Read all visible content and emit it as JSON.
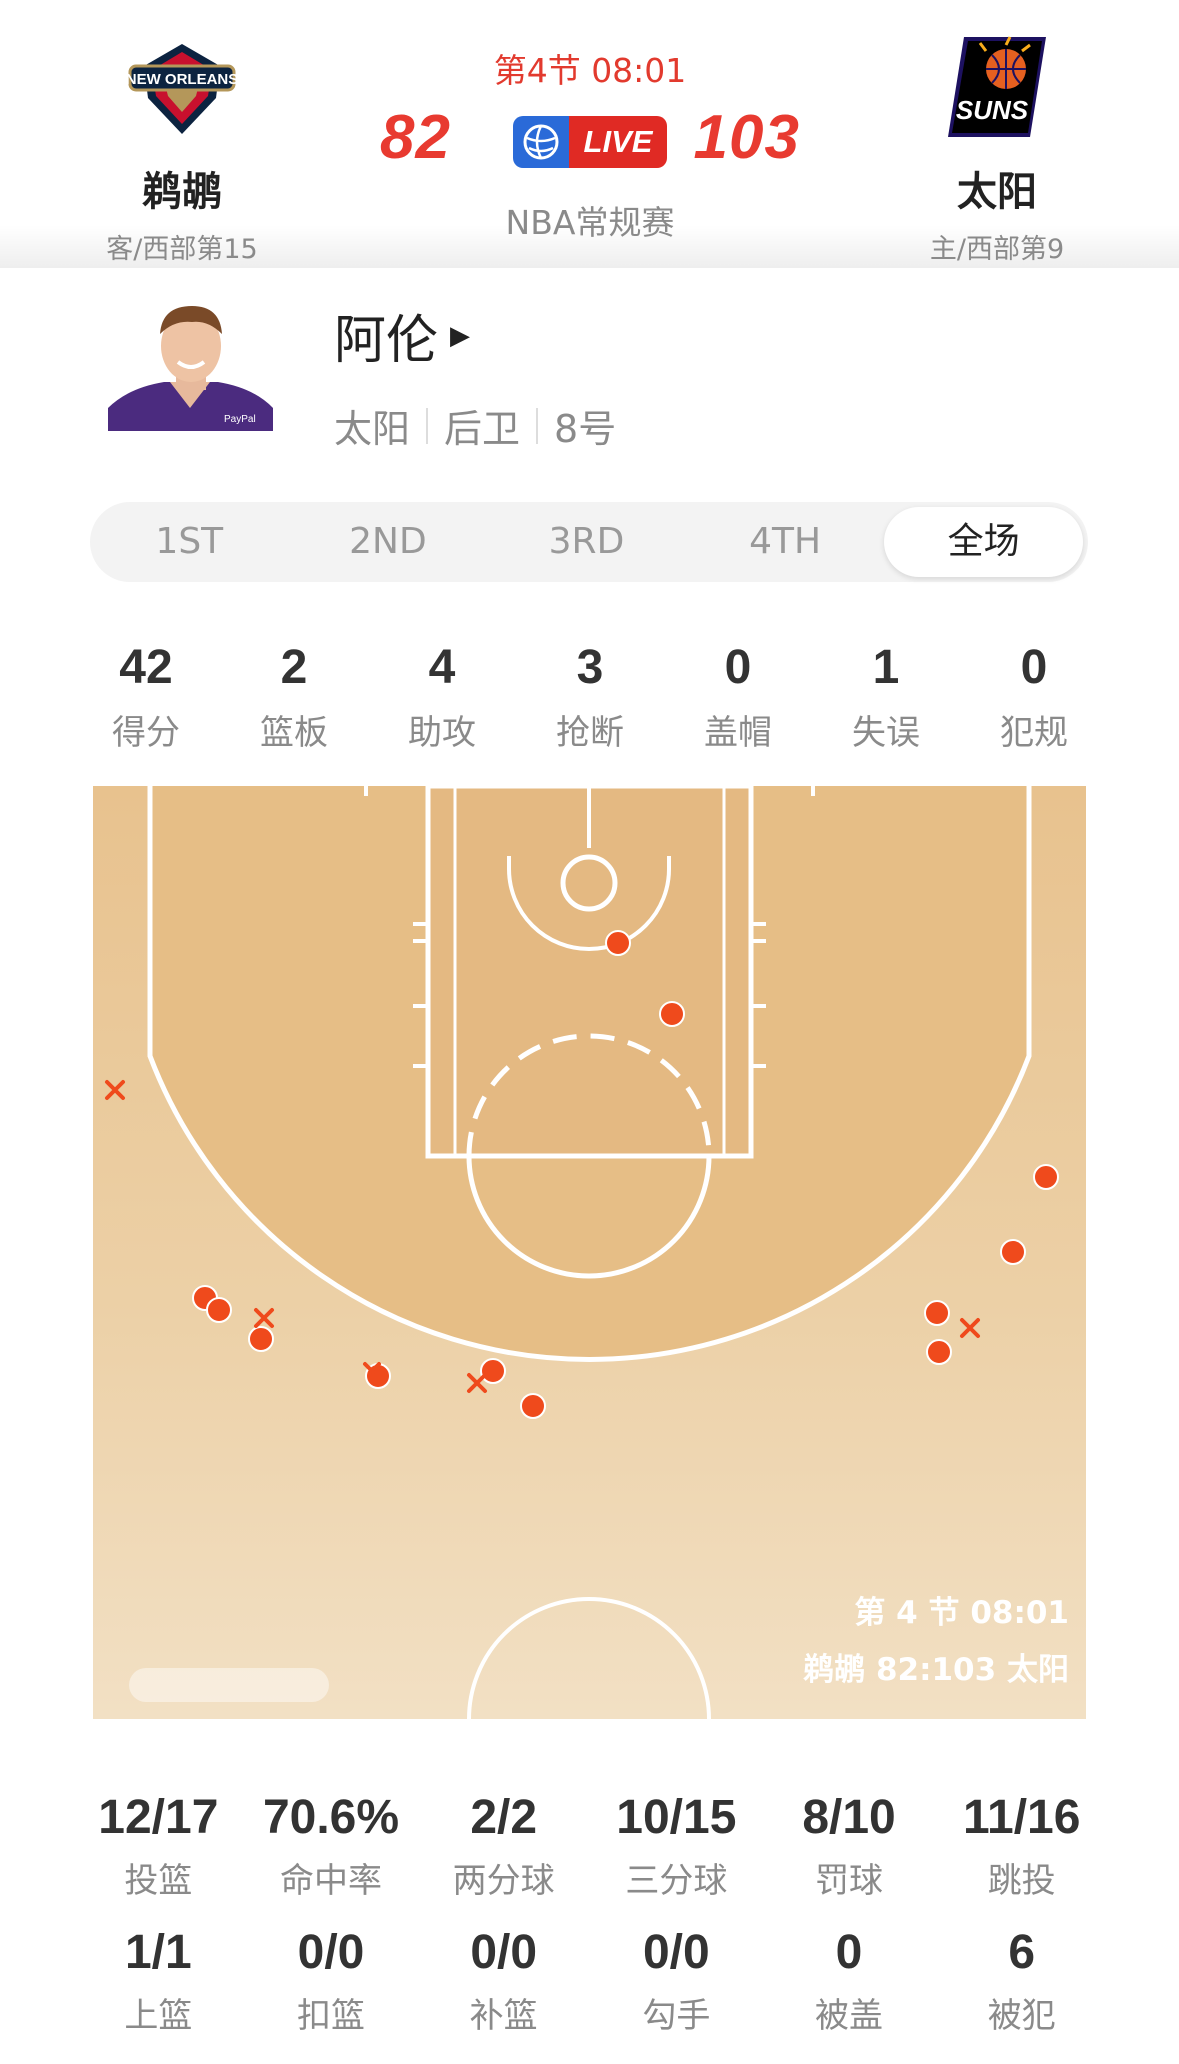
{
  "game": {
    "period_time": "第4节 08:01",
    "status_badge": "LIVE",
    "league": "NBA常规赛",
    "away": {
      "name": "鹈鹕",
      "sub": "客/西部第15",
      "score": "82",
      "logo": "pelicans-logo"
    },
    "home": {
      "name": "太阳",
      "sub": "主/西部第9",
      "score": "103",
      "logo": "suns-logo"
    }
  },
  "player": {
    "name": "阿伦",
    "team": "太阳",
    "position": "后卫",
    "number": "8号"
  },
  "tabs": [
    {
      "label": "1ST",
      "active": false
    },
    {
      "label": "2ND",
      "active": false
    },
    {
      "label": "3RD",
      "active": false
    },
    {
      "label": "4TH",
      "active": false
    },
    {
      "label": "全场",
      "active": true
    }
  ],
  "summary": [
    {
      "value": "42",
      "label": "得分"
    },
    {
      "value": "2",
      "label": "篮板"
    },
    {
      "value": "4",
      "label": "助攻"
    },
    {
      "value": "3",
      "label": "抢断"
    },
    {
      "value": "0",
      "label": "盖帽"
    },
    {
      "value": "1",
      "label": "失误"
    },
    {
      "value": "0",
      "label": "犯规"
    }
  ],
  "court": {
    "overlay_time": "第 4 节 08:01",
    "overlay_score": "鹈鹕 82:103 太阳",
    "made_color": "#ef4a1c",
    "missed_color": "#ef4a1c"
  },
  "shooting_row1": [
    {
      "value": "12/17",
      "label": "投篮"
    },
    {
      "value": "70.6%",
      "label": "命中率"
    },
    {
      "value": "2/2",
      "label": "两分球"
    },
    {
      "value": "10/15",
      "label": "三分球"
    },
    {
      "value": "8/10",
      "label": "罚球"
    },
    {
      "value": "11/16",
      "label": "跳投"
    }
  ],
  "shooting_row2": [
    {
      "value": "1/1",
      "label": "上篮"
    },
    {
      "value": "0/0",
      "label": "扣篮"
    },
    {
      "value": "0/0",
      "label": "补篮"
    },
    {
      "value": "0/0",
      "label": "勾手"
    },
    {
      "value": "0",
      "label": "被盖"
    },
    {
      "value": "6",
      "label": "被犯"
    }
  ]
}
